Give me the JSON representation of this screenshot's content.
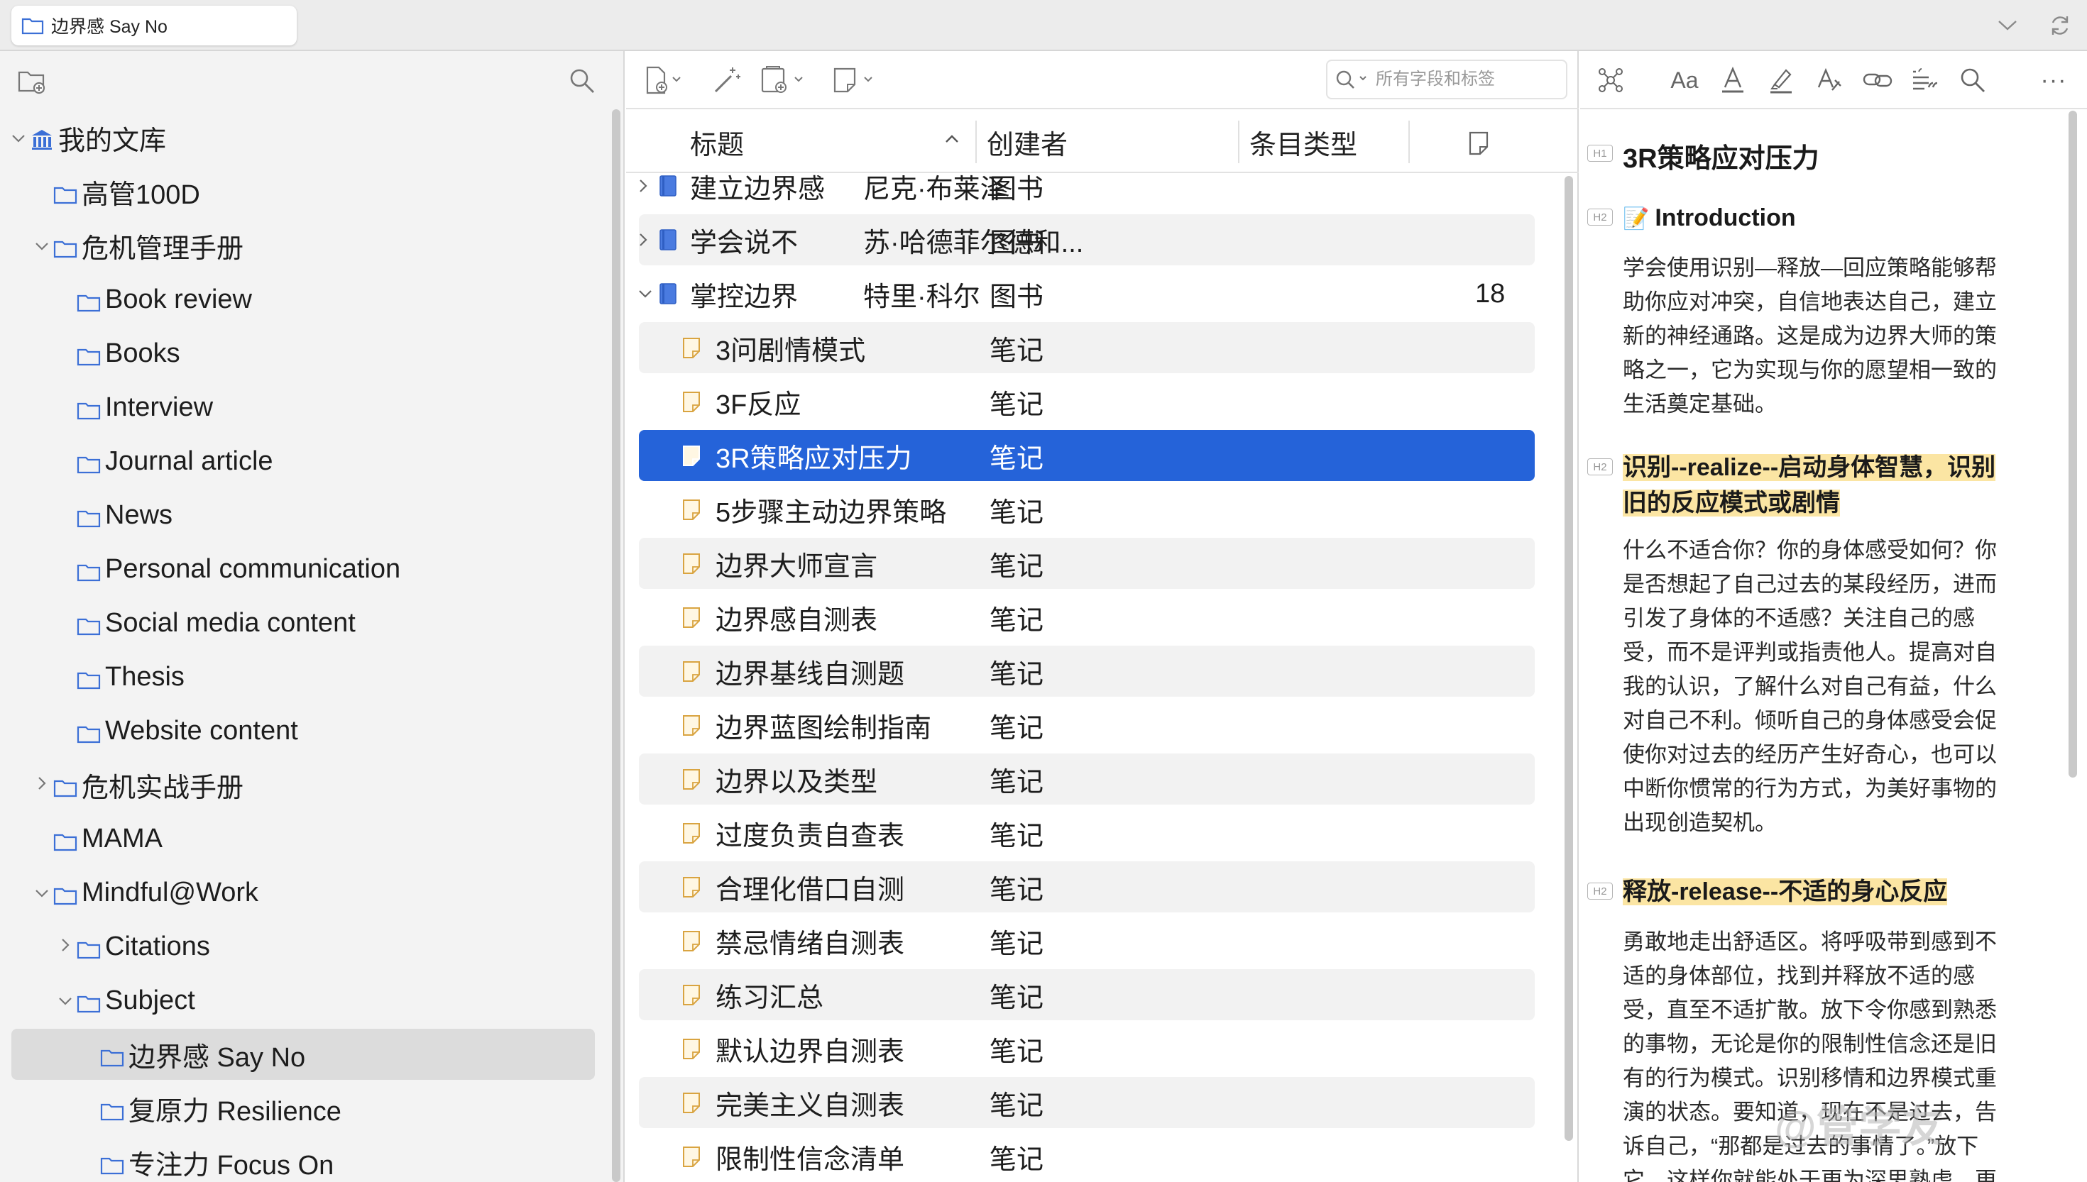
{
  "tab": {
    "title": "边界感 Say No"
  },
  "library": {
    "items": [
      {
        "label": "我的文库",
        "chevron": "down",
        "icon": "library-icon",
        "depth": 0
      },
      {
        "label": "高管100D",
        "chevron": "",
        "icon": "folder-icon",
        "depth": 1
      },
      {
        "label": "危机管理手册",
        "chevron": "down",
        "icon": "folder-icon",
        "depth": 1
      },
      {
        "label": "Book review",
        "chevron": "",
        "icon": "folder-icon",
        "depth": 2
      },
      {
        "label": "Books",
        "chevron": "",
        "icon": "folder-icon",
        "depth": 2
      },
      {
        "label": "Interview",
        "chevron": "",
        "icon": "folder-icon",
        "depth": 2
      },
      {
        "label": "Journal article",
        "chevron": "",
        "icon": "folder-icon",
        "depth": 2
      },
      {
        "label": "News",
        "chevron": "",
        "icon": "folder-icon",
        "depth": 2
      },
      {
        "label": "Personal communication",
        "chevron": "",
        "icon": "folder-icon",
        "depth": 2
      },
      {
        "label": "Social media content",
        "chevron": "",
        "icon": "folder-icon",
        "depth": 2
      },
      {
        "label": "Thesis",
        "chevron": "",
        "icon": "folder-icon",
        "depth": 2
      },
      {
        "label": "Website content",
        "chevron": "",
        "icon": "folder-icon",
        "depth": 2
      },
      {
        "label": "危机实战手册",
        "chevron": "right",
        "icon": "folder-icon",
        "depth": 1
      },
      {
        "label": "MAMA",
        "chevron": "",
        "icon": "folder-icon",
        "depth": 1
      },
      {
        "label": "Mindful@Work",
        "chevron": "down",
        "icon": "folder-icon",
        "depth": 1
      },
      {
        "label": "Citations",
        "chevron": "right",
        "icon": "folder-icon",
        "depth": 2
      },
      {
        "label": "Subject",
        "chevron": "down",
        "icon": "folder-icon",
        "depth": 2
      },
      {
        "label": "边界感 Say No",
        "chevron": "",
        "icon": "folder-icon",
        "depth": 3,
        "selected": true
      },
      {
        "label": "复原力 Resilience",
        "chevron": "",
        "icon": "folder-icon",
        "depth": 3
      },
      {
        "label": "专注力 Focus On",
        "chevron": "",
        "icon": "folder-icon",
        "depth": 3
      }
    ]
  },
  "search": {
    "placeholder": "所有字段和标签"
  },
  "columns": {
    "title": "标题",
    "creator": "创建者",
    "item_type": "条目类型",
    "notes_icon": "note-icon"
  },
  "items": [
    {
      "title": "建立边界感",
      "creator": "尼克·布莱泽",
      "type": "图书",
      "count": "",
      "kind": "book",
      "chevron": "right"
    },
    {
      "title": "学会说不",
      "creator": "苏·哈德菲尔德和...",
      "type": "图书",
      "count": "",
      "kind": "book",
      "chevron": "right"
    },
    {
      "title": "掌控边界",
      "creator": "特里·科尔",
      "type": "图书",
      "count": "18",
      "kind": "book",
      "chevron": "down"
    },
    {
      "title": "3问剧情模式",
      "creator": "",
      "type": "笔记",
      "count": "",
      "kind": "note"
    },
    {
      "title": "3F反应",
      "creator": "",
      "type": "笔记",
      "count": "",
      "kind": "note"
    },
    {
      "title": "3R策略应对压力",
      "creator": "",
      "type": "笔记",
      "count": "",
      "kind": "note",
      "selected": true
    },
    {
      "title": "5步骤主动边界策略",
      "creator": "",
      "type": "笔记",
      "count": "",
      "kind": "note"
    },
    {
      "title": "边界大师宣言",
      "creator": "",
      "type": "笔记",
      "count": "",
      "kind": "note"
    },
    {
      "title": "边界感自测表",
      "creator": "",
      "type": "笔记",
      "count": "",
      "kind": "note"
    },
    {
      "title": "边界基线自测题",
      "creator": "",
      "type": "笔记",
      "count": "",
      "kind": "note"
    },
    {
      "title": "边界蓝图绘制指南",
      "creator": "",
      "type": "笔记",
      "count": "",
      "kind": "note"
    },
    {
      "title": "边界以及类型",
      "creator": "",
      "type": "笔记",
      "count": "",
      "kind": "note"
    },
    {
      "title": "过度负责自查表",
      "creator": "",
      "type": "笔记",
      "count": "",
      "kind": "note"
    },
    {
      "title": "合理化借口自测",
      "creator": "",
      "type": "笔记",
      "count": "",
      "kind": "note"
    },
    {
      "title": "禁忌情绪自测表",
      "creator": "",
      "type": "笔记",
      "count": "",
      "kind": "note"
    },
    {
      "title": "练习汇总",
      "creator": "",
      "type": "笔记",
      "count": "",
      "kind": "note"
    },
    {
      "title": "默认边界自测表",
      "creator": "",
      "type": "笔记",
      "count": "",
      "kind": "note"
    },
    {
      "title": "完美主义自测表",
      "creator": "",
      "type": "笔记",
      "count": "",
      "kind": "note"
    },
    {
      "title": "限制性信念清单",
      "creator": "",
      "type": "笔记",
      "count": "",
      "kind": "note"
    }
  ],
  "note": {
    "h1": "3R策略应对压力",
    "h1_badge": "H1",
    "h2_badge": "H2",
    "sections": [
      {
        "heading_emoji": "📝",
        "heading": "Introduction",
        "highlight": false,
        "lines": [
          "学会使用识别—释放—回应策略能够帮",
          "助你应对冲突，自信地表达自己，建立",
          "新的神经通路。这是成为边界大师的策",
          "略之一，它为实现与你的愿望相一致的",
          "生活奠定基础。"
        ]
      },
      {
        "heading_emoji": "",
        "heading_lines": [
          "识别--realize--启动身体智慧，识别",
          "旧的反应模式或剧情"
        ],
        "highlight": true,
        "lines": [
          "什么不适合你？你的身体感受如何？你",
          "是否想起了自己过去的某段经历，进而",
          "引发了身体的不适感？关注自己的感",
          "受，而不是评判或指责他人。提高对自",
          "我的认识，了解什么对自己有益，什么",
          "对自己不利。倾听自己的身体感受会促",
          "使你对过去的经历产生好奇心，也可以",
          "中断你惯常的行为方式，为美好事物的",
          "出现创造契机。"
        ]
      },
      {
        "heading_emoji": "",
        "heading_lines": [
          "释放-release--不适的身心反应"
        ],
        "highlight": true,
        "lines": [
          "勇敢地走出舒适区。将呼吸带到感到不",
          "适的身体部位，找到并释放不适的感",
          "受，直至不适扩散。放下令你感到熟悉",
          "的事物，无论是你的限制性信念还是旧",
          "有的行为模式。识别移情和边界模式重",
          "演的状态。要知道，现在不是过去，告",
          "诉自己，“那都是过去的事情了。”放下",
          "它，这样你就能处于更为深思熟虑、更"
        ]
      }
    ]
  },
  "watermark": "@管学友",
  "colors": {
    "accent": "#2563d9",
    "highlight": "#fbe5a3",
    "pane_bg": "#f3f3f3",
    "folder": "#3b6fd6"
  }
}
